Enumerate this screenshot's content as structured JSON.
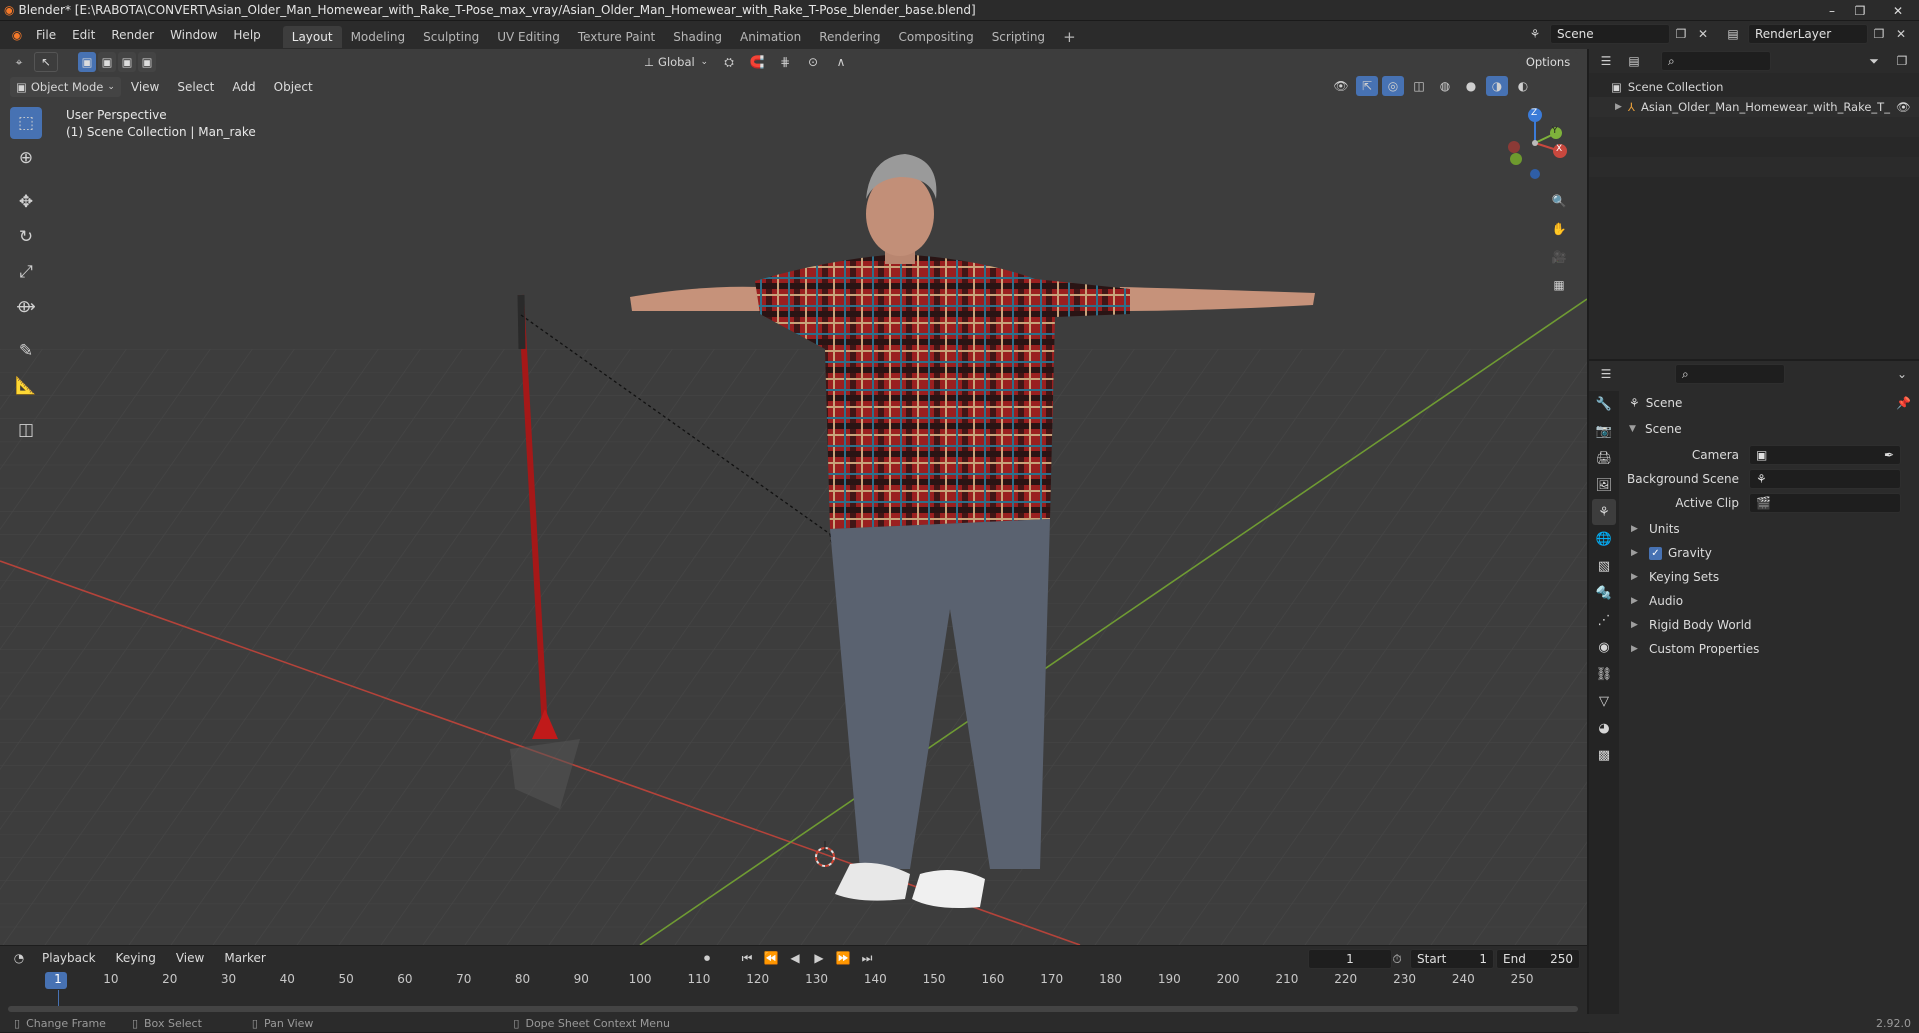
{
  "window": {
    "title": "Blender* [E:\\RABOTA\\CONVERT\\Asian_Older_Man_Homewear_with_Rake_T-Pose_max_vray/Asian_Older_Man_Homewear_with_Rake_T-Pose_blender_base.blend]",
    "minimize": "–",
    "maximize": "❐",
    "close": "✕"
  },
  "menubar": {
    "items": [
      "File",
      "Edit",
      "Render",
      "Window",
      "Help"
    ]
  },
  "workspaces": {
    "tabs": [
      "Layout",
      "Modeling",
      "Sculpting",
      "UV Editing",
      "Texture Paint",
      "Shading",
      "Animation",
      "Rendering",
      "Compositing",
      "Scripting"
    ],
    "active": "Layout",
    "add": "+"
  },
  "scene_selector": {
    "value": "Scene"
  },
  "view_layer_selector": {
    "value": "RenderLayer"
  },
  "viewport_header": {
    "mode": "Object Mode",
    "menus": [
      "View",
      "Select",
      "Add",
      "Object"
    ],
    "transform_orientation": "Global",
    "options": "Options"
  },
  "viewport": {
    "perspective_label": "User Perspective",
    "collection_label": "(1) Scene Collection | Man_rake",
    "gizmo": {
      "x": "X",
      "y": "Y",
      "z": "Z"
    }
  },
  "outliner": {
    "root": "Scene Collection",
    "items": [
      {
        "name": "Asian_Older_Man_Homewear_with_Rake_T_"
      }
    ]
  },
  "properties": {
    "context": "Scene",
    "panel_title": "Scene",
    "fields": [
      {
        "label": "Camera",
        "value": ""
      },
      {
        "label": "Background Scene",
        "value": ""
      },
      {
        "label": "Active Clip",
        "value": ""
      }
    ],
    "subpanels": [
      {
        "label": "Units",
        "checkbox": false
      },
      {
        "label": "Gravity",
        "checkbox": true,
        "checked": true
      },
      {
        "label": "Keying Sets",
        "checkbox": false
      },
      {
        "label": "Audio",
        "checkbox": false
      },
      {
        "label": "Rigid Body World",
        "checkbox": false
      },
      {
        "label": "Custom Properties",
        "checkbox": false
      }
    ]
  },
  "timeline": {
    "menus": [
      "Playback",
      "Keying",
      "View",
      "Marker"
    ],
    "current_frame": "1",
    "start_label": "Start",
    "start": "1",
    "end_label": "End",
    "end": "250",
    "ticks": [
      "1",
      "10",
      "20",
      "30",
      "40",
      "50",
      "60",
      "70",
      "80",
      "90",
      "100",
      "110",
      "120",
      "130",
      "140",
      "150",
      "160",
      "170",
      "180",
      "190",
      "200",
      "210",
      "220",
      "230",
      "240",
      "250"
    ]
  },
  "statusbar": {
    "hints": [
      "Change Frame",
      "Box Select",
      "Pan View",
      "Dope Sheet Context Menu"
    ],
    "version": "2.92.0"
  },
  "colors": {
    "accent": "#4772b3",
    "x_axis": "#c8483e",
    "y_axis": "#7eb23b",
    "z_axis": "#3b7bd8",
    "viewport_bg": "#3d3d3d"
  }
}
